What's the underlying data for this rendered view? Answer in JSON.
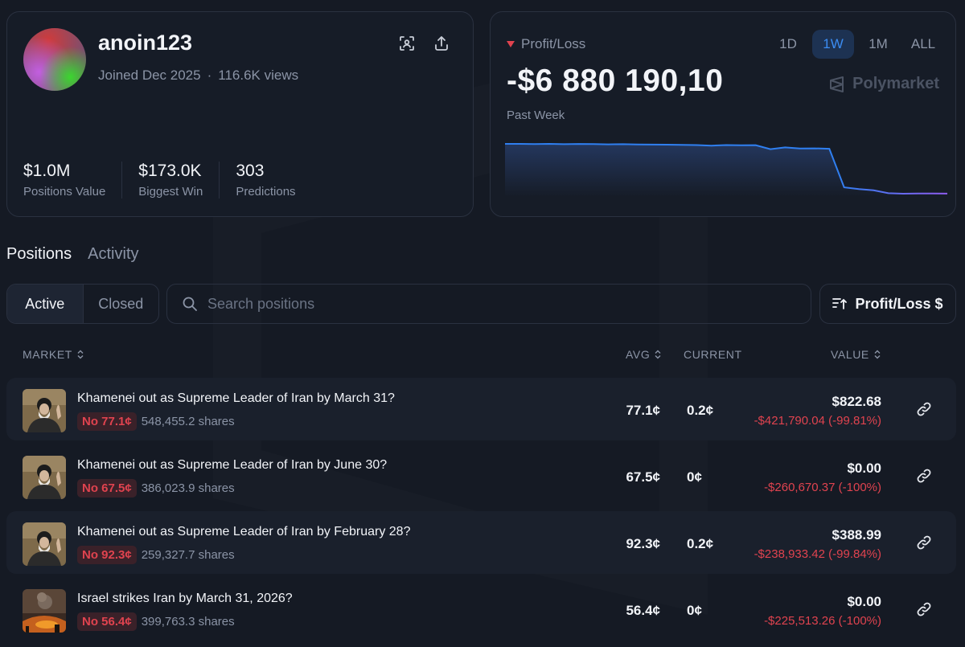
{
  "profile": {
    "username": "anoin123",
    "joined": "Joined Dec 2025",
    "separator": "·",
    "views": "116.6K views",
    "stats": [
      {
        "value": "$1.0M",
        "label": "Positions Value"
      },
      {
        "value": "$173.0K",
        "label": "Biggest Win"
      },
      {
        "value": "303",
        "label": "Predictions"
      }
    ]
  },
  "pnl": {
    "label": "Profit/Loss",
    "amount": "-$6 880 190,10",
    "period": "Past Week",
    "brand": "Polymarket",
    "ranges": [
      "1D",
      "1W",
      "1M",
      "ALL"
    ],
    "active_range": "1W",
    "colors": {
      "line_start": "#2f7ff0",
      "line_end": "#8f5cf0",
      "negative": "#e0434f"
    }
  },
  "chart_data": {
    "type": "line",
    "values": [
      100,
      100,
      99.8,
      100,
      99.7,
      99.9,
      99.8,
      99.6,
      99.7,
      99.5,
      99.4,
      99.3,
      99.2,
      99.0,
      98.5,
      99.0,
      98.8,
      98.9,
      95.5,
      97.0,
      96.0,
      96.2,
      95.8,
      63.0,
      61.5,
      60.5,
      58.0,
      57.6,
      57.8,
      57.8,
      57.7
    ],
    "xlabel": "",
    "ylabel": ""
  },
  "tabs": [
    "Positions",
    "Activity"
  ],
  "active_tab": "Positions",
  "filter": {
    "active": "Active",
    "closed": "Closed"
  },
  "search": {
    "placeholder": "Search positions"
  },
  "sort_label": "Profit/Loss $",
  "table": {
    "headers": {
      "market": "MARKET",
      "avg": "AVG",
      "current": "CURRENT",
      "value": "VALUE"
    },
    "rows": [
      {
        "title": "Khamenei out as Supreme Leader of Iran by March 31?",
        "outcome": "No 77.1¢",
        "shares": "548,455.2 shares",
        "avg": "77.1¢",
        "current": "0.2¢",
        "value": "$822.68",
        "change": "-$421,790.04 (-99.81%)",
        "thumb": "portrait"
      },
      {
        "title": "Khamenei out as Supreme Leader of Iran by June 30?",
        "outcome": "No 67.5¢",
        "shares": "386,023.9 shares",
        "avg": "67.5¢",
        "current": "0¢",
        "value": "$0.00",
        "change": "-$260,670.37 (-100%)",
        "thumb": "portrait"
      },
      {
        "title": "Khamenei out as Supreme Leader of Iran by February 28?",
        "outcome": "No 92.3¢",
        "shares": "259,327.7 shares",
        "avg": "92.3¢",
        "current": "0.2¢",
        "value": "$388.99",
        "change": "-$238,933.42 (-99.84%)",
        "thumb": "portrait"
      },
      {
        "title": "Israel strikes Iran by March 31, 2026?",
        "outcome": "No 56.4¢",
        "shares": "399,763.3 shares",
        "avg": "56.4¢",
        "current": "0¢",
        "value": "$0.00",
        "change": "-$225,513.26 (-100%)",
        "thumb": "explosion"
      }
    ]
  }
}
